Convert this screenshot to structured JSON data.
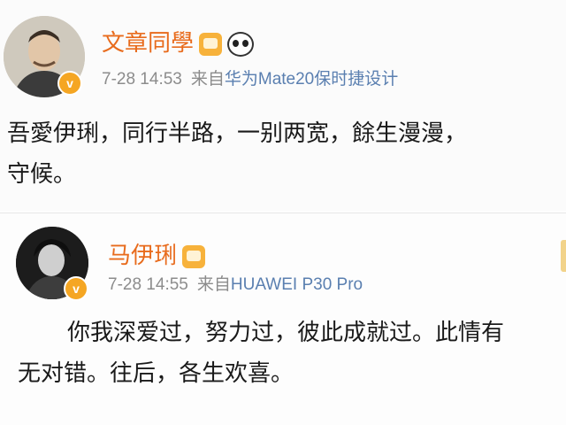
{
  "posts": [
    {
      "username": "文章同學",
      "time": "7-28 14:53",
      "from": "来自",
      "device": "华为Mate20保时捷设计",
      "lines": [
        "吾愛伊琍，同行半路，一别两宽，餘生漫漫，",
        "守候。"
      ]
    },
    {
      "username": "马伊琍",
      "time": "7-28 14:55",
      "from": "来自",
      "device": "HUAWEI P30 Pro",
      "lines": [
        "你我深爱过，努力过，彼此成就过。此情有",
        "无对错。往后，各生欢喜。"
      ]
    }
  ],
  "colors": {
    "username": "#e86b1c",
    "meta": "#8c8c8c",
    "verified": "#f5a623"
  },
  "icons": [
    "verified-badge-icon",
    "crown-emoji-icon",
    "panda-emoji-icon"
  ]
}
